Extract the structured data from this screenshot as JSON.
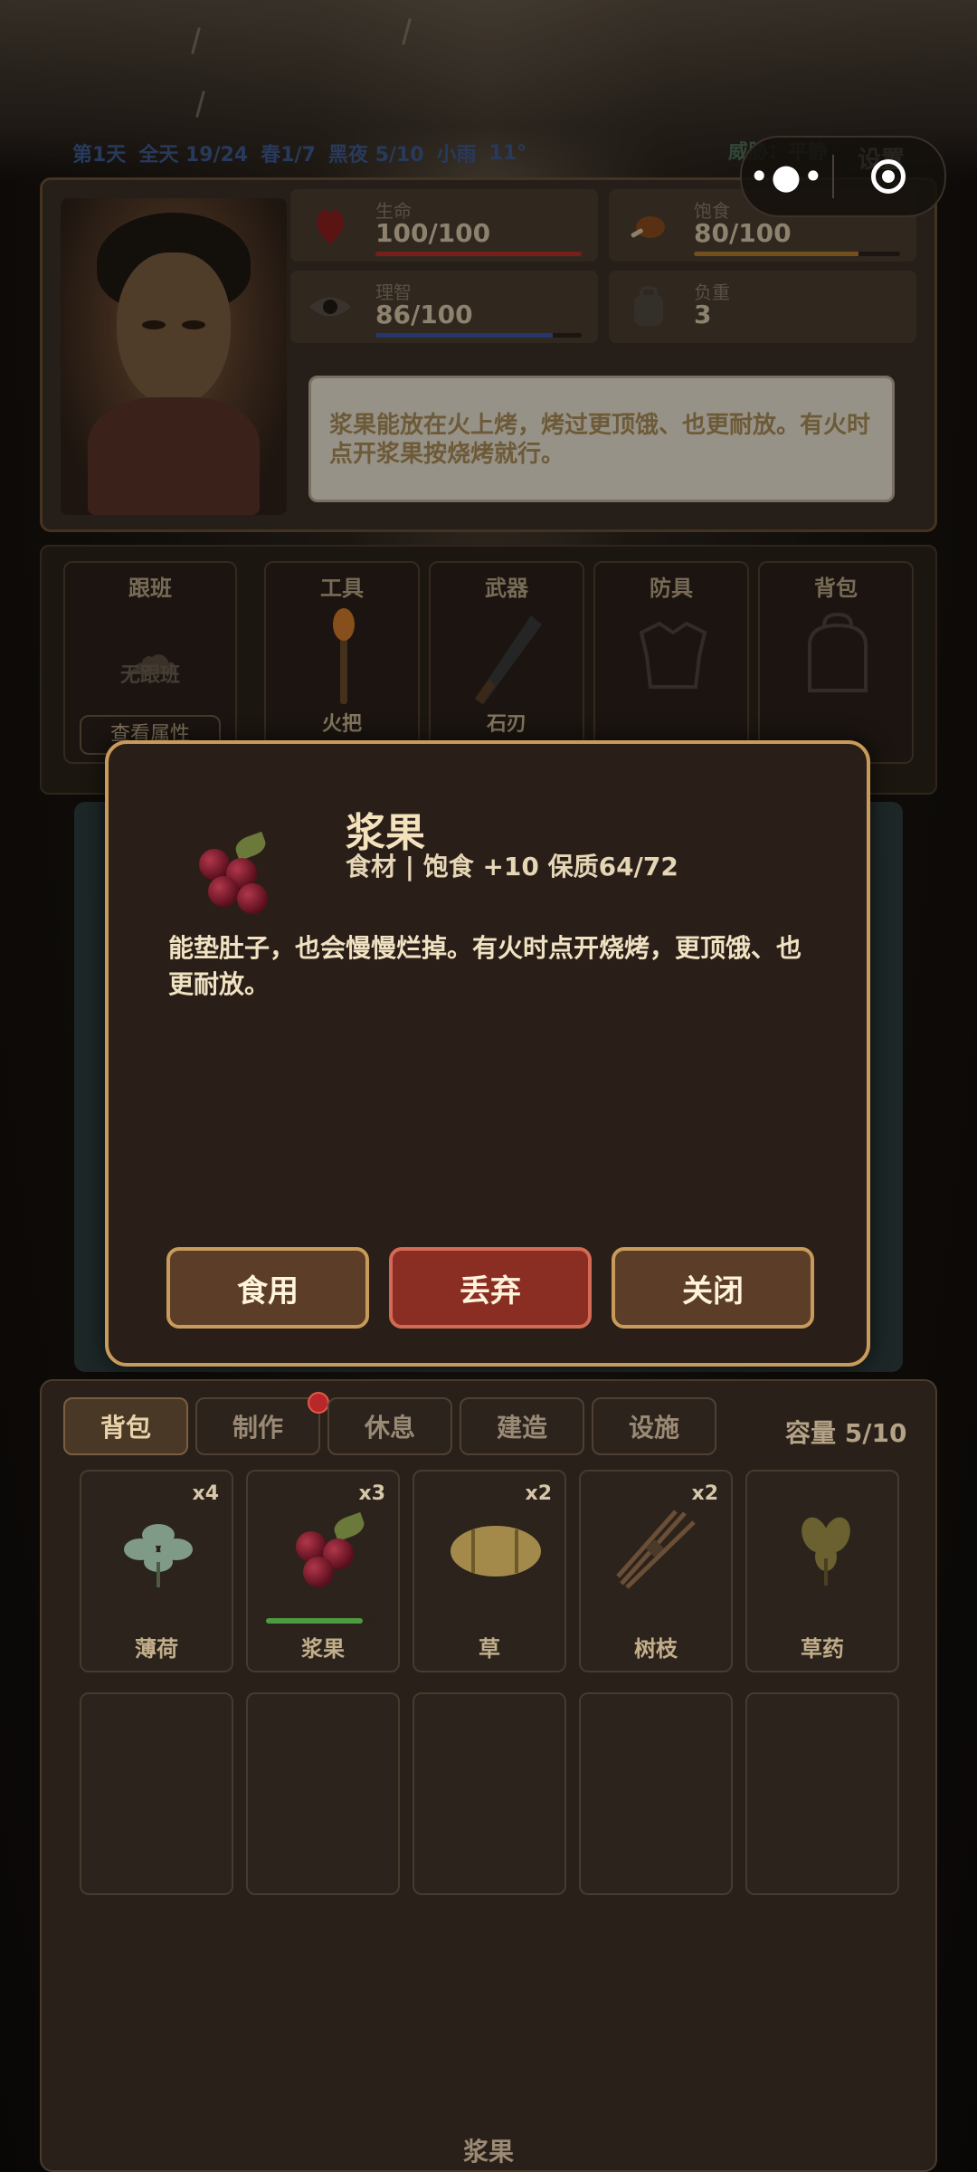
{
  "status_bar": {
    "day": "第1天",
    "time": "全天 19/24",
    "season": "春1/7",
    "night": "黑夜 5/10",
    "weather": "小雨",
    "temperature": "11°",
    "threat": "威胁：平静",
    "settings_label": "设置"
  },
  "miniprogram_capsule": {
    "more_icon": "more-dots-icon",
    "close_icon": "target-circle-icon"
  },
  "character": {
    "stats": [
      {
        "label": "生命",
        "value": "100/100",
        "icon": "heart-icon",
        "fill": 1.0,
        "color": "#b5312a"
      },
      {
        "label": "饱食",
        "value": "80/100",
        "icon": "roast-meat-icon",
        "fill": 0.8,
        "color": "#b07a2a"
      },
      {
        "label": "理智",
        "value": "86/100",
        "icon": "eye-icon",
        "fill": 0.86,
        "color": "#3a55a8"
      },
      {
        "label": "负重",
        "value": "3",
        "icon": "backpack-icon"
      }
    ],
    "tip": "浆果能放在火上烤，烤过更顶饿、也更耐放。有火时点开浆果按烧烤就行。"
  },
  "equipment": {
    "slots": [
      {
        "title": "跟班",
        "name": "无跟班",
        "button": "查看属性",
        "icon": "companion-icon"
      },
      {
        "title": "工具",
        "name": "火把",
        "icon": "torch-icon"
      },
      {
        "title": "武器",
        "name": "石刃",
        "icon": "stone-blade-icon"
      },
      {
        "title": "防具",
        "name": "",
        "icon": "armor-icon"
      },
      {
        "title": "背包",
        "name": "",
        "icon": "bag-icon"
      }
    ]
  },
  "modal": {
    "item_name": "浆果",
    "item_icon": "berry-icon",
    "meta": "食材 | 饱食 +10 保质64/72",
    "description": "能垫肚子，也会慢慢烂掉。有火时点开烧烤，更顶饿、也更耐放。",
    "buttons": {
      "eat": "食用",
      "discard": "丢弃",
      "close": "关闭"
    }
  },
  "inventory": {
    "tabs": [
      "背包",
      "制作",
      "休息",
      "建造",
      "设施"
    ],
    "active_tab": "背包",
    "capacity": "容量 5/10",
    "items": [
      {
        "name": "薄荷",
        "qty": "x4",
        "icon": "mint-icon"
      },
      {
        "name": "浆果",
        "qty": "x3",
        "icon": "berry-icon",
        "freshness": 0.89
      },
      {
        "name": "草",
        "qty": "x2",
        "icon": "hay-icon"
      },
      {
        "name": "树枝",
        "qty": "x2",
        "icon": "twigs-icon"
      },
      {
        "name": "草药",
        "qty": "",
        "icon": "herb-icon"
      }
    ],
    "selected_label": "浆果"
  },
  "colors": {
    "accent_gold": "#c89b5a",
    "danger_red": "#8a2e24",
    "fresh_green": "#4d9b40"
  }
}
